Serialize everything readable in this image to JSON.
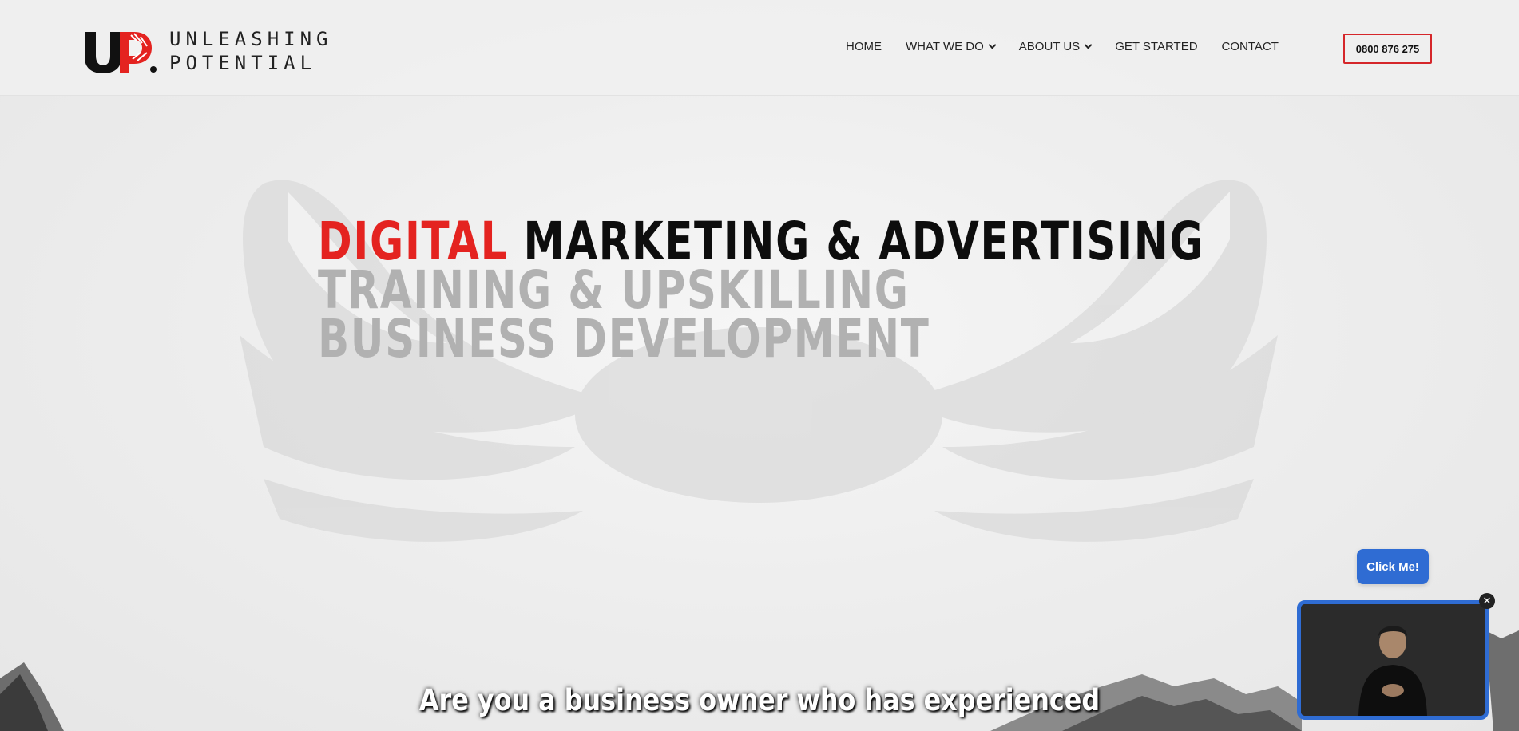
{
  "brand": {
    "line1": "UNLEASHING",
    "line2": "POTENTIAL",
    "accent_color": "#e42320"
  },
  "nav": {
    "items": [
      {
        "label": "HOME",
        "has_dropdown": false
      },
      {
        "label": "WHAT WE DO",
        "has_dropdown": true
      },
      {
        "label": "ABOUT US",
        "has_dropdown": true
      },
      {
        "label": "GET STARTED",
        "has_dropdown": false
      },
      {
        "label": "CONTACT",
        "has_dropdown": false
      }
    ],
    "phone": "0800 876 275"
  },
  "hero": {
    "line1_red": "DIGITAL",
    "line1_black": "MARKETING & ADVERTISING",
    "line2": "TRAINING & UPSKILLING",
    "line3": "BUSINESS DEVELOPMENT"
  },
  "widget": {
    "click_label": "Click Me!",
    "close_symbol": "✕",
    "button_color": "#2f6cd3"
  },
  "caption": "Are you a business owner who has experienced"
}
